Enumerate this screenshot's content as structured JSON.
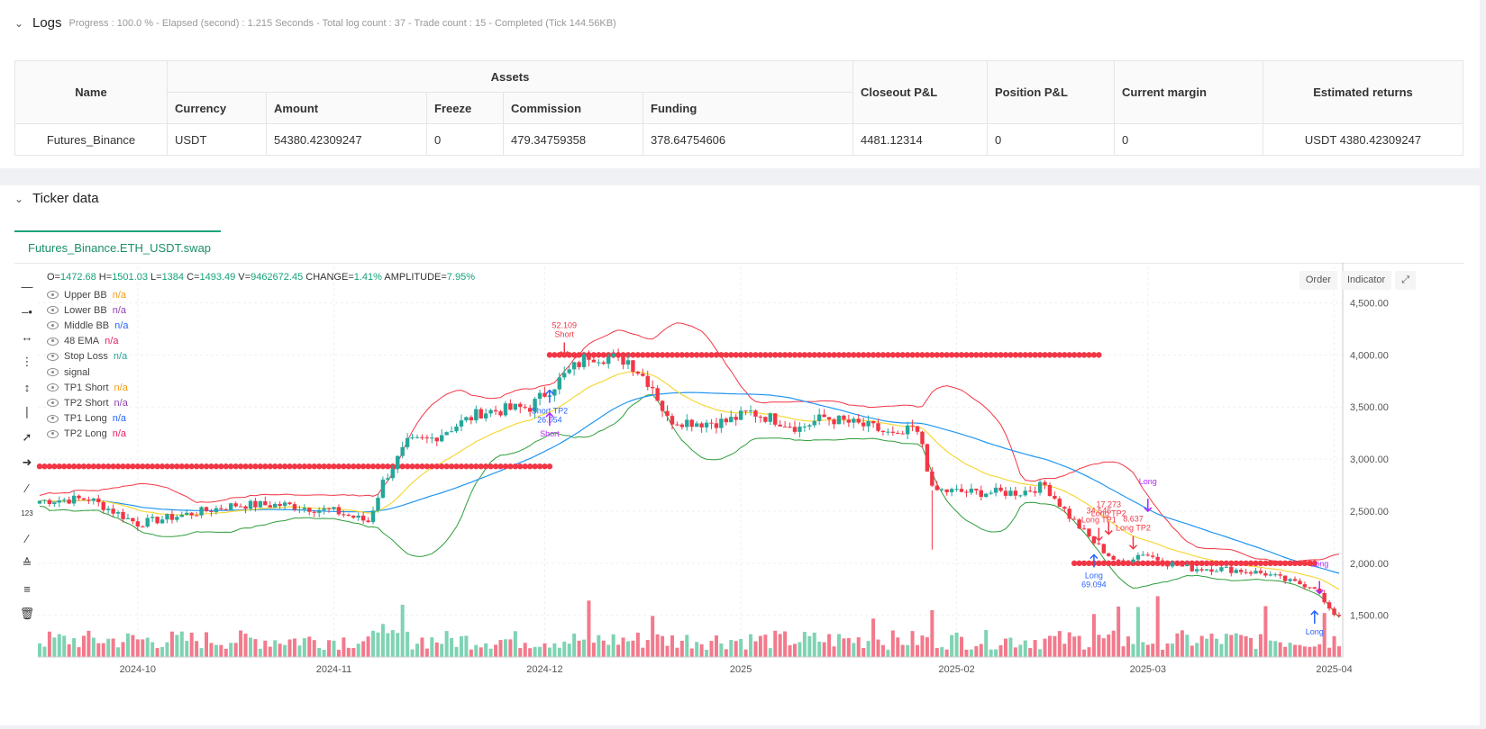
{
  "logs": {
    "title": "Logs",
    "status": "Progress : 100.0 % - Elapsed (second) : 1.215 Seconds - Total log count : 37 - Trade count : 15 - Completed (Tick 144.56KB)",
    "table": {
      "group_header": "Assets",
      "headers": [
        "Name",
        "Currency",
        "Amount",
        "Freeze",
        "Commission",
        "Funding",
        "Closeout P&L",
        "Position P&L",
        "Current margin",
        "Estimated returns"
      ],
      "row": [
        "Futures_Binance",
        "USDT",
        "54380.42309247",
        "0",
        "479.34759358",
        "378.64754606",
        "4481.12314",
        "0",
        "0",
        "USDT 4380.42309247"
      ]
    }
  },
  "ticker": {
    "title": "Ticker data",
    "tab": "Futures_Binance.ETH_USDT.swap",
    "buttons": [
      "Order",
      "Indicator"
    ],
    "ohlc": {
      "O": "1472.68",
      "H": "1501.03",
      "L": "1384",
      "C": "1493.49",
      "V": "9462672.45",
      "CHANGE": "1.41%",
      "AMPLITUDE": "7.95%"
    },
    "legend": [
      {
        "name": "Upper BB",
        "value": "n/a",
        "color": "#f39c12"
      },
      {
        "name": "Lower BB",
        "value": "n/a",
        "color": "#8e44ad"
      },
      {
        "name": "Middle BB",
        "value": "n/a",
        "color": "#2962ff"
      },
      {
        "name": "48 EMA",
        "value": "n/a",
        "color": "#e91e63"
      },
      {
        "name": "Stop Loss",
        "value": "n/a",
        "color": "#26a69a"
      },
      {
        "name": "signal",
        "value": "",
        "color": "#444"
      },
      {
        "name": "TP1 Short",
        "value": "n/a",
        "color": "#f39c12"
      },
      {
        "name": "TP2 Short",
        "value": "n/a",
        "color": "#8e44ad"
      },
      {
        "name": "TP1 Long",
        "value": "n/a",
        "color": "#2962ff"
      },
      {
        "name": "TP2 Long",
        "value": "n/a",
        "color": "#e91e63"
      }
    ]
  },
  "chart_data": {
    "type": "candlestick",
    "y_ticks": [
      "4,500.00",
      "4,000.00",
      "3,500.00",
      "3,000.00",
      "2,500.00",
      "2,000.00",
      "1,500.00"
    ],
    "x_ticks": [
      "2024-10",
      "2024-11",
      "2024-12",
      "2025",
      "2025-02",
      "2025-03",
      "2025-04"
    ],
    "ylim": [
      1100,
      4850
    ],
    "colors": {
      "up": "#26a69a",
      "down": "#f23645",
      "upper_bb": "#f23645",
      "lower_bb": "#2e9d3a",
      "middle_bb": "#2196f3",
      "ema": "#f5d83a",
      "stop": "#f23645"
    },
    "close_anchors": [
      [
        0,
        2600
      ],
      [
        10,
        2620
      ],
      [
        20,
        2380
      ],
      [
        30,
        2470
      ],
      [
        40,
        2560
      ],
      [
        50,
        2560
      ],
      [
        60,
        2500
      ],
      [
        67,
        2400
      ],
      [
        70,
        2780
      ],
      [
        75,
        3150
      ],
      [
        80,
        3200
      ],
      [
        90,
        3450
      ],
      [
        100,
        3500
      ],
      [
        107,
        3800
      ],
      [
        112,
        4000
      ],
      [
        120,
        3950
      ],
      [
        125,
        3700
      ],
      [
        128,
        3380
      ],
      [
        135,
        3350
      ],
      [
        140,
        3360
      ],
      [
        145,
        3450
      ],
      [
        150,
        3380
      ],
      [
        155,
        3300
      ],
      [
        160,
        3400
      ],
      [
        165,
        3350
      ],
      [
        170,
        3300
      ],
      [
        175,
        3200
      ],
      [
        178,
        3300
      ],
      [
        180,
        3150
      ],
      [
        182,
        2700
      ],
      [
        190,
        2680
      ],
      [
        200,
        2680
      ],
      [
        205,
        2750
      ],
      [
        210,
        2450
      ],
      [
        215,
        2200
      ],
      [
        220,
        2000
      ],
      [
        225,
        2100
      ],
      [
        230,
        2000
      ],
      [
        235,
        1950
      ],
      [
        240,
        1950
      ],
      [
        245,
        1930
      ],
      [
        250,
        1900
      ],
      [
        255,
        1820
      ],
      [
        260,
        1780
      ],
      [
        263,
        1540
      ],
      [
        265,
        1493
      ]
    ],
    "stop_levels": [
      {
        "from": 0,
        "to": 104,
        "price": 2930
      },
      {
        "from": 104,
        "to": 216,
        "price": 4000
      },
      {
        "from": 211,
        "to": 260,
        "price": 2000
      }
    ],
    "signals": [
      {
        "label": "52.109",
        "sub": "Short",
        "color": "#f23645"
      },
      {
        "label": "Short TP2",
        "sub": "26.054",
        "color": "#2962ff"
      },
      {
        "label": "Short",
        "sub": "",
        "color": "#b026ff"
      },
      {
        "label": "Long",
        "sub": "69.094",
        "color": "#2962ff"
      },
      {
        "label": "17.273",
        "sub": "Long TP2",
        "color": "#f23645"
      },
      {
        "label": "34.546",
        "sub": "Long TP1",
        "color": "#f23645"
      },
      {
        "label": "8.637",
        "sub": "Long TP2",
        "color": "#f23645"
      },
      {
        "label": "Long",
        "sub": "",
        "color": "#b026ff"
      },
      {
        "label": "Long",
        "sub": "",
        "color": "#b026ff"
      },
      {
        "label": "Long",
        "sub": "",
        "color": "#2962ff"
      }
    ]
  }
}
